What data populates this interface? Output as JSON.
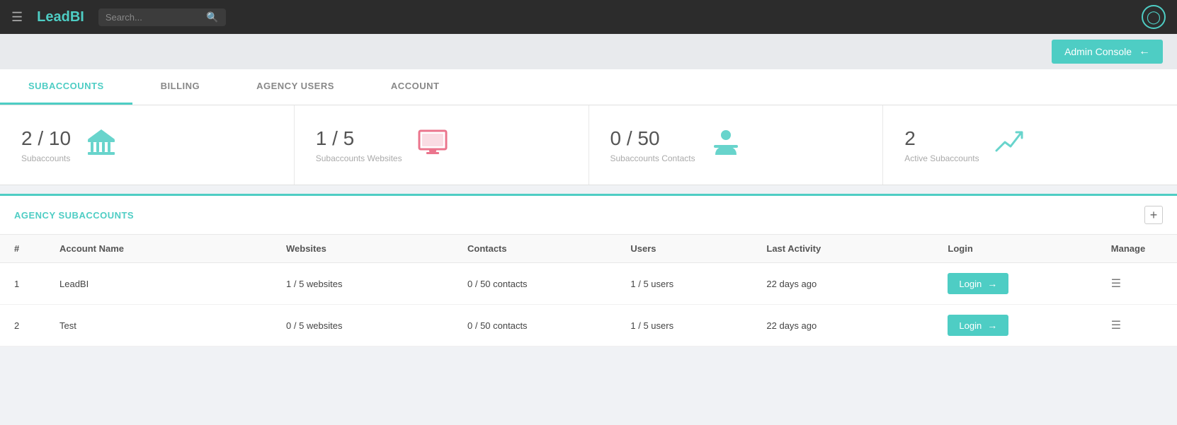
{
  "app": {
    "logo_lead": "Lead",
    "logo_bi": "BI"
  },
  "topnav": {
    "search_placeholder": "Search...",
    "admin_console_label": "Admin Console"
  },
  "tabs": [
    {
      "id": "subaccounts",
      "label": "SUBACCOUNTS",
      "active": true
    },
    {
      "id": "billing",
      "label": "BILLING",
      "active": false
    },
    {
      "id": "agency-users",
      "label": "AGENCY USERS",
      "active": false
    },
    {
      "id": "account",
      "label": "ACCOUNT",
      "active": false
    }
  ],
  "stats": [
    {
      "id": "subaccounts",
      "number": "2 / 10",
      "label": "Subaccounts",
      "icon_type": "bank"
    },
    {
      "id": "websites",
      "number": "1 / 5",
      "label": "Subaccounts Websites",
      "icon_type": "screen"
    },
    {
      "id": "contacts",
      "number": "0 / 50",
      "label": "Subaccounts Contacts",
      "icon_type": "person"
    },
    {
      "id": "active",
      "number": "2",
      "label": "Active Subaccounts",
      "icon_type": "trend"
    }
  ],
  "agency_section": {
    "title": "AGENCY SUBACCOUNTS"
  },
  "table": {
    "headers": [
      "#",
      "Account Name",
      "Websites",
      "Contacts",
      "Users",
      "Last Activity",
      "Login",
      "Manage"
    ],
    "rows": [
      {
        "num": "1",
        "account_name": "LeadBI",
        "websites": "1 / 5 websites",
        "contacts": "0 / 50 contacts",
        "users": "1 / 5 users",
        "last_activity": "22 days ago",
        "login_label": "Login"
      },
      {
        "num": "2",
        "account_name": "Test",
        "websites": "0 / 5 websites",
        "contacts": "0 / 50 contacts",
        "users": "1 / 5 users",
        "last_activity": "22 days ago",
        "login_label": "Login"
      }
    ]
  }
}
